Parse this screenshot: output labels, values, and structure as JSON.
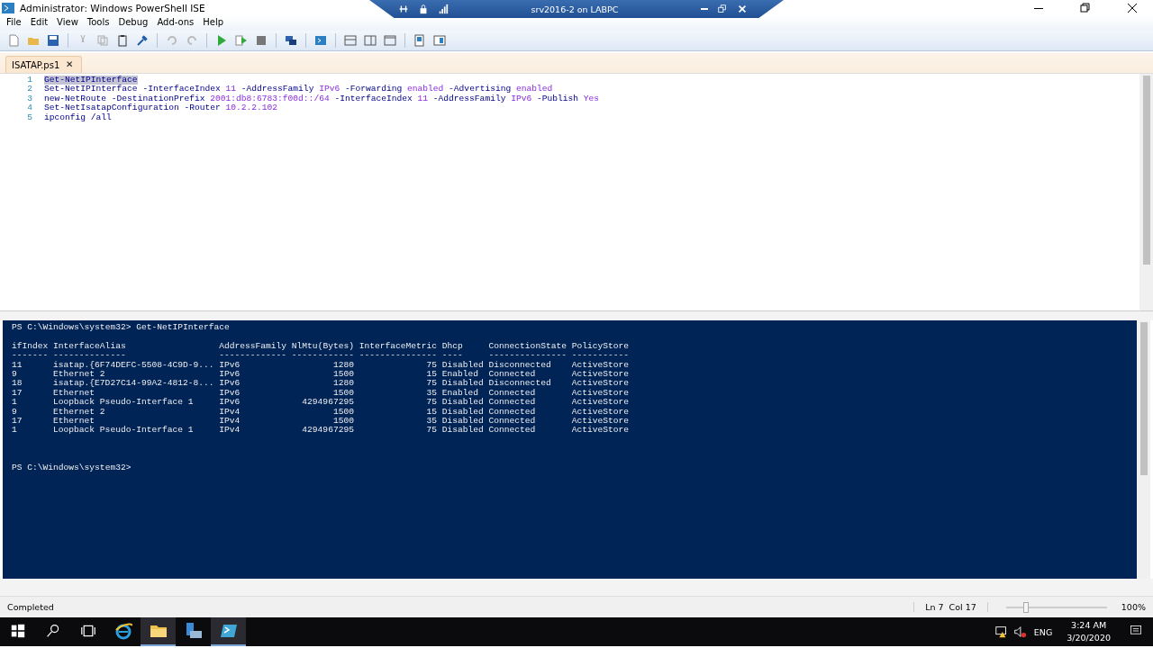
{
  "window": {
    "title": "Administrator: Windows PowerShell ISE"
  },
  "remote_bar": {
    "title": "srv2016-2 on LABPC"
  },
  "menu": [
    "File",
    "Edit",
    "View",
    "Tools",
    "Debug",
    "Add-ons",
    "Help"
  ],
  "tabs": [
    {
      "label": "ISATAP.ps1",
      "selected": true
    }
  ],
  "script": [
    {
      "number": "1",
      "selected": true,
      "tokens": [
        {
          "kind": "command",
          "text": "Get-NetIPInterface"
        }
      ]
    },
    {
      "number": "2",
      "selected": false,
      "tokens": [
        {
          "kind": "command",
          "text": "Set-NetIPInterface -InterfaceIndex "
        },
        {
          "kind": "argument",
          "text": "11"
        },
        {
          "kind": "command",
          "text": " -AddressFamily "
        },
        {
          "kind": "argument",
          "text": "IPv6"
        },
        {
          "kind": "command",
          "text": " -Forwarding "
        },
        {
          "kind": "argument",
          "text": "enabled"
        },
        {
          "kind": "command",
          "text": " -Advertising "
        },
        {
          "kind": "argument",
          "text": "enabled"
        }
      ]
    },
    {
      "number": "3",
      "selected": false,
      "tokens": [
        {
          "kind": "command",
          "text": "new-NetRoute -DestinationPrefix "
        },
        {
          "kind": "argument",
          "text": "2001:db8:6783:f00d::/64"
        },
        {
          "kind": "command",
          "text": " -InterfaceIndex "
        },
        {
          "kind": "argument",
          "text": "11"
        },
        {
          "kind": "command",
          "text": " -AddressFamily "
        },
        {
          "kind": "argument",
          "text": "IPv6"
        },
        {
          "kind": "command",
          "text": " -Publish "
        },
        {
          "kind": "argument",
          "text": "Yes"
        }
      ]
    },
    {
      "number": "4",
      "selected": false,
      "tokens": [
        {
          "kind": "command",
          "text": "Set-NetIsatapConfiguration -Router "
        },
        {
          "kind": "argument",
          "text": "10.2.2.102"
        }
      ]
    },
    {
      "number": "5",
      "selected": false,
      "tokens": [
        {
          "kind": "command",
          "text": "ipconfig /all"
        }
      ]
    }
  ],
  "console": {
    "command_prompt": "PS C:\\Windows\\system32> Get-NetIPInterface",
    "table": {
      "columns": [
        {
          "label": "ifIndex",
          "rule": "-------"
        },
        {
          "label": "InterfaceAlias",
          "rule": "--------------"
        },
        {
          "label": "AddressFamily",
          "rule": "-------------"
        },
        {
          "label": "NlMtu(Bytes)",
          "rule": "------------"
        },
        {
          "label": "InterfaceMetric",
          "rule": "---------------"
        },
        {
          "label": "Dhcp",
          "rule": "----"
        },
        {
          "label": "ConnectionState",
          "rule": "---------------"
        },
        {
          "label": "PolicyStore",
          "rule": "-----------"
        }
      ],
      "rows": [
        [
          "11",
          "isatap.{6F74DEFC-5508-4C9D-9...",
          "IPv6",
          "1280",
          "75",
          "Disabled",
          "Disconnected",
          "ActiveStore"
        ],
        [
          "9",
          "Ethernet 2",
          "IPv6",
          "1500",
          "15",
          "Enabled",
          "Connected",
          "ActiveStore"
        ],
        [
          "18",
          "isatap.{E7D27C14-99A2-4812-8...",
          "IPv6",
          "1280",
          "75",
          "Disabled",
          "Disconnected",
          "ActiveStore"
        ],
        [
          "17",
          "Ethernet",
          "IPv6",
          "1500",
          "35",
          "Enabled",
          "Connected",
          "ActiveStore"
        ],
        [
          "1",
          "Loopback Pseudo-Interface 1",
          "IPv6",
          "4294967295",
          "75",
          "Disabled",
          "Connected",
          "ActiveStore"
        ],
        [
          "9",
          "Ethernet 2",
          "IPv4",
          "1500",
          "15",
          "Disabled",
          "Connected",
          "ActiveStore"
        ],
        [
          "17",
          "Ethernet",
          "IPv4",
          "1500",
          "35",
          "Disabled",
          "Connected",
          "ActiveStore"
        ],
        [
          "1",
          "Loopback Pseudo-Interface 1",
          "IPv4",
          "4294967295",
          "75",
          "Disabled",
          "Connected",
          "ActiveStore"
        ]
      ]
    },
    "prompt": "PS C:\\Windows\\system32>"
  },
  "status_bar": {
    "status": "Completed",
    "position": "Ln 7  Col 17",
    "zoom_slider": {
      "level": 0.2
    },
    "zoom": "100%"
  },
  "taskbar": {
    "apps": [
      {
        "kind": "ie",
        "selected": false
      },
      {
        "kind": "explorer",
        "selected": true
      },
      {
        "kind": "server",
        "selected": false
      },
      {
        "kind": "powershell",
        "selected": true
      }
    ],
    "language": "ENG",
    "time": "3:24 AM",
    "date": "3/20/2020"
  }
}
